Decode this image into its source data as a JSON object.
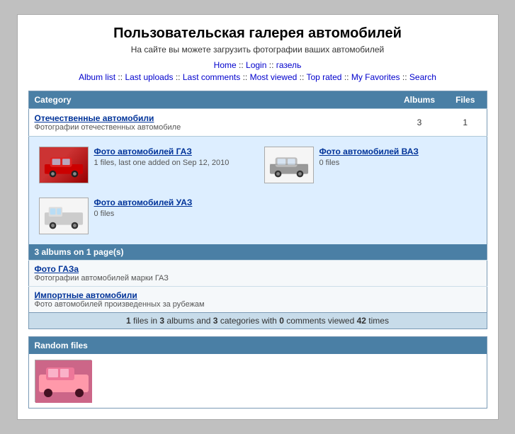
{
  "site": {
    "title": "Пользовательская галерея автомобилей",
    "subtitle": "На сайте вы можете загрузить фотографии ваших автомобилей"
  },
  "nav_top": {
    "items": [
      {
        "label": "Home",
        "href": "#"
      },
      {
        "label": "Login",
        "href": "#"
      },
      {
        "label": "газель",
        "href": "#"
      }
    ]
  },
  "nav_bottom": {
    "items": [
      {
        "label": "Album list",
        "href": "#"
      },
      {
        "label": "Last uploads",
        "href": "#"
      },
      {
        "label": "Last comments",
        "href": "#"
      },
      {
        "label": "Most viewed",
        "href": "#"
      },
      {
        "label": "Top rated",
        "href": "#"
      },
      {
        "label": "My Favorites",
        "href": "#"
      },
      {
        "label": "Search",
        "href": "#"
      }
    ]
  },
  "table": {
    "headers": {
      "category": "Category",
      "albums": "Albums",
      "files": "Files"
    },
    "main_category": {
      "name": "Отечественные автомобили",
      "desc": "Фотографии отечественных автомобиле",
      "albums_count": "3",
      "files_count": "1"
    },
    "subalbums": [
      {
        "name": "Фото автомобилей ГАЗ",
        "files_text": "1 files, last one added on Sep 12, 2010",
        "has_thumb": true,
        "thumb_type": "gaz"
      },
      {
        "name": "Фото автомобилей ВАЗ",
        "files_text": "0 files",
        "has_thumb": true,
        "thumb_type": "vaz"
      },
      {
        "name": "Фото автомобилей УАЗ",
        "files_text": "0 files",
        "has_thumb": true,
        "thumb_type": "uaz"
      }
    ],
    "albums_summary": "3 albums on 1 page(s)",
    "sub_categories": [
      {
        "name": "Фото ГАЗа",
        "desc": "Фотографии автомобилей марки ГАЗ"
      },
      {
        "name": "Импортные автомобили",
        "desc": "Фото автомобилей произведенных за рубежам"
      }
    ],
    "info": "1 files in 3 albums and 3 categories with 0 comments viewed 42 times"
  },
  "random": {
    "header": "Random files"
  }
}
